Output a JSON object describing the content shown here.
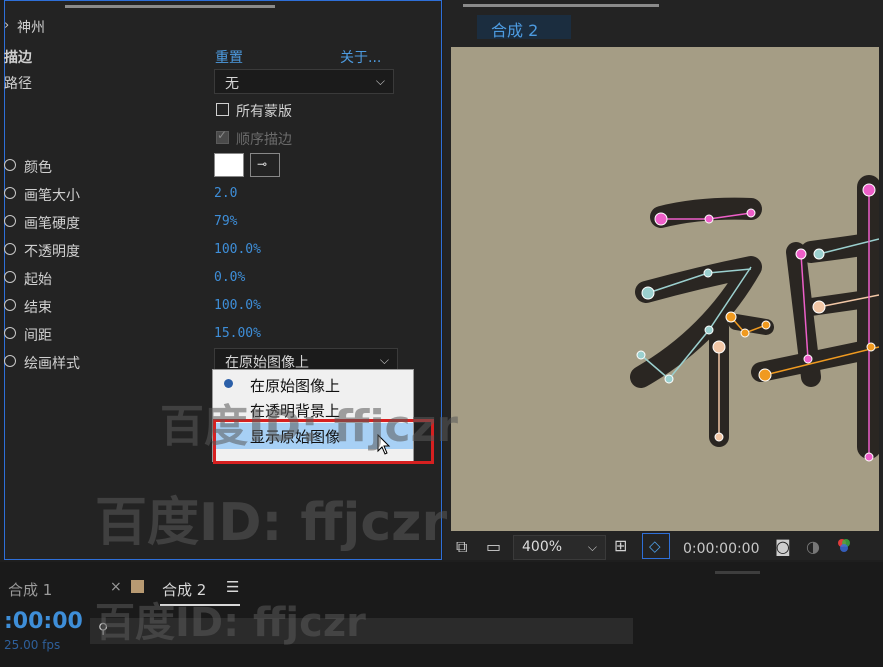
{
  "effect_panel": {
    "layer_name": "神州",
    "effect_name": "描边",
    "reset_label": "重置",
    "about_label": "关于...",
    "path_label": "路径",
    "path_value": "无",
    "all_masks_label": "所有蒙版",
    "sequential_label": "顺序描边",
    "properties": [
      {
        "label": "颜色"
      },
      {
        "label": "画笔大小",
        "value": "2.0"
      },
      {
        "label": "画笔硬度",
        "value": "79%"
      },
      {
        "label": "不透明度",
        "value": "100.0%"
      },
      {
        "label": "起始",
        "value": "0.0%"
      },
      {
        "label": "结束",
        "value": "100.0%"
      },
      {
        "label": "间距",
        "value": "15.00%"
      }
    ],
    "paint_style_label": "绘画样式",
    "paint_style_value": "在原始图像上",
    "color_value": "#ffffff"
  },
  "paint_style_menu": {
    "options": [
      "在原始图像上",
      "在透明背景上",
      "显示原始图像"
    ],
    "selected_index": 0,
    "hover_index": 2
  },
  "composition": {
    "tab_label": "合成 2",
    "zoom": "400%",
    "timecode": "0:00:00:00",
    "glyph": "神",
    "background": "#a59d85"
  },
  "timeline": {
    "tabs": [
      "合成 1",
      "合成 2"
    ],
    "current_time": ":00:00",
    "fps": "25.00 fps"
  },
  "watermark": "百度ID: ffjczr"
}
